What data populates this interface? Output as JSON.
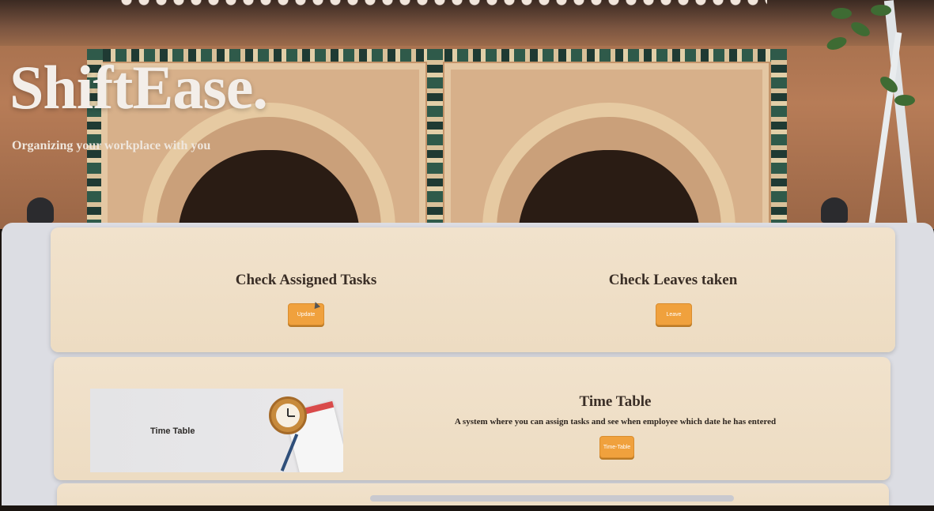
{
  "hero": {
    "brand": "ShiftEase.",
    "tagline": "Organizing your workplace with you"
  },
  "cards": {
    "assigned": {
      "title": "Check Assigned Tasks",
      "button": "Update"
    },
    "leaves": {
      "title": "Check Leaves taken",
      "button": "Leave"
    },
    "timetable": {
      "image_label": "Time Table",
      "title": "Time Table",
      "description": "A system where you can assign tasks and see when employee which date he has entered",
      "button": "Time-Table"
    }
  },
  "colors": {
    "accent": "#f0a13d",
    "card": "#f1e2cc",
    "text": "#3a2e26"
  },
  "icons": [
    "clock-icon",
    "calendar-icon"
  ]
}
